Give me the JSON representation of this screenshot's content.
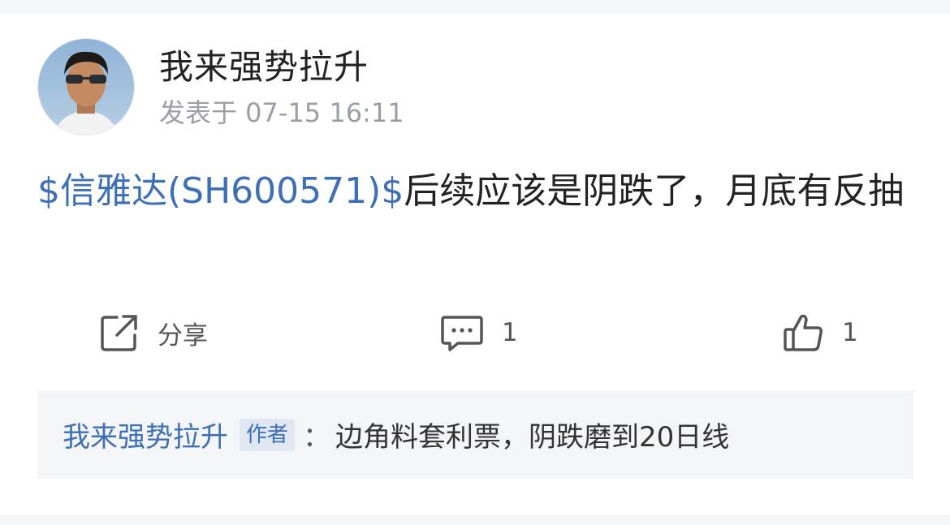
{
  "post": {
    "author": "我来强势拉升",
    "time": "发表于 07-15 16:11",
    "stock_link": "$信雅达(SH600571)$",
    "body_text": "后续应该是阴跌了，月底有反抽"
  },
  "actions": {
    "share_label": "分享",
    "comment_count": "1",
    "like_count": "1"
  },
  "comment": {
    "author": "我来强势拉升",
    "tag": "作者",
    "separator": "：",
    "text": "边角料套利票，阴跌磨到20日线"
  },
  "icons": [
    "avatar",
    "share-icon",
    "comment-icon",
    "thumbs-up-icon"
  ],
  "colors": {
    "link": "#3c6fb5",
    "text": "#222222",
    "muted": "#9a9ea6",
    "comment_bg": "#f4f5f8"
  }
}
